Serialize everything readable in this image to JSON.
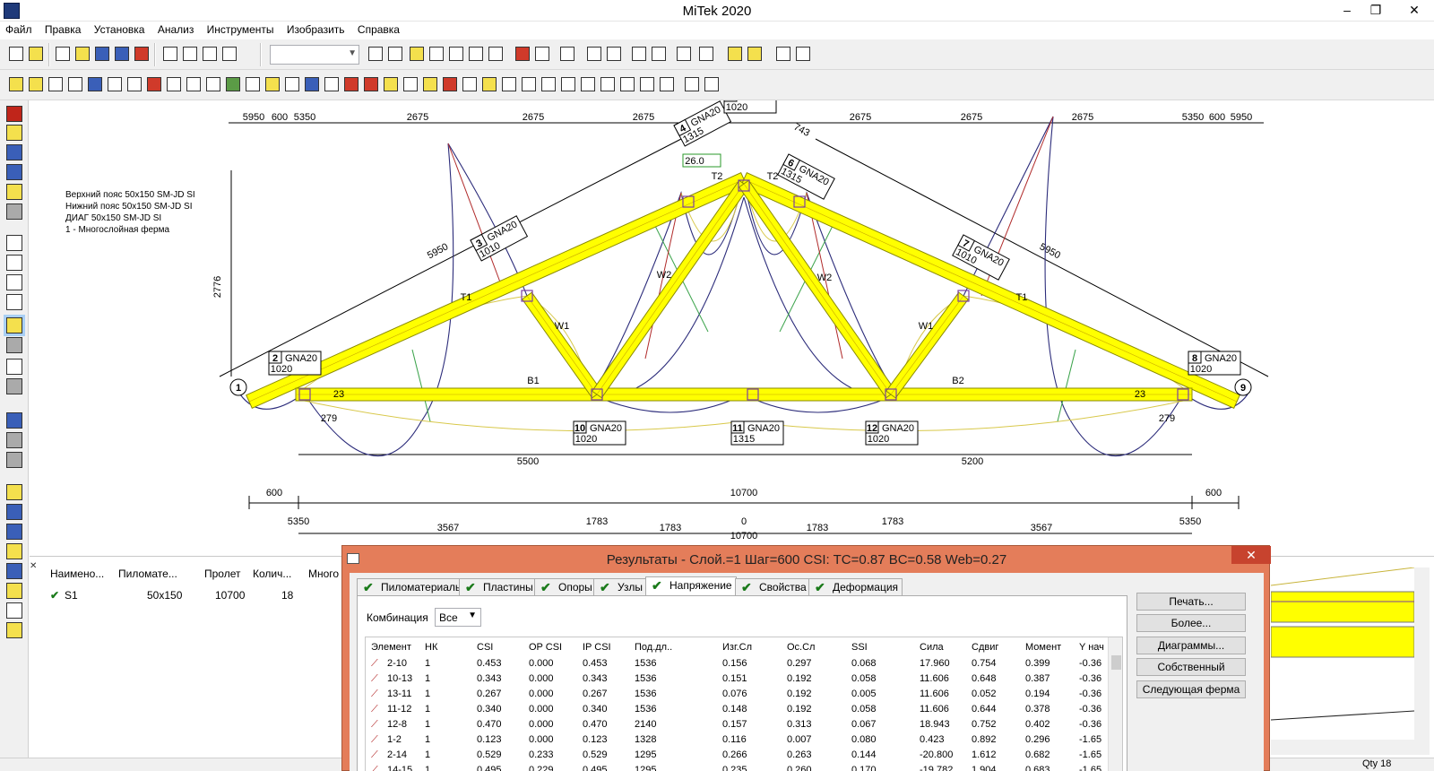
{
  "window": {
    "title": "MiTek 2020",
    "minimize_glyph": "–",
    "restore_glyph": "❐",
    "close_glyph": "✕"
  },
  "menu": {
    "items": [
      "Файл",
      "Правка",
      "Установка",
      "Анализ",
      "Инструменты",
      "Изобразить",
      "Справка"
    ]
  },
  "drawing": {
    "material_notes": [
      "Верхний пояс 50x150 SM-JD SI",
      "Нижний пояс 50x150 SM-JD SI",
      "ДИАГ 50x150 SM-JD SI",
      "1 - Многослойная ферма"
    ],
    "top_dims": [
      "5950",
      "600",
      "5350",
      "2675",
      "2675",
      "2675",
      "2675",
      "2675",
      "2675",
      "5350",
      "600",
      "5950"
    ],
    "height_dim": "2776",
    "slope_dims": [
      "5950",
      "5950",
      "743",
      "743"
    ],
    "member_labels": [
      "T1",
      "T1",
      "T2",
      "T2",
      "W1",
      "W1",
      "W2",
      "W2",
      "B1",
      "B2"
    ],
    "plates": [
      {
        "num": "2",
        "type": "GNA20",
        "size": "1020"
      },
      {
        "num": "3",
        "type": "GNA20",
        "size": "1010"
      },
      {
        "num": "4",
        "type": "GNA20",
        "size": "1315"
      },
      {
        "num": "5",
        "type": "GNA20",
        "size": "1020"
      },
      {
        "num": "6",
        "type": "GNA20",
        "size": "1315"
      },
      {
        "num": "7",
        "type": "GNA20",
        "size": "1010"
      },
      {
        "num": "8",
        "type": "GNA20",
        "size": "1020"
      },
      {
        "num": "10",
        "type": "GNA20",
        "size": "1020"
      },
      {
        "num": "11",
        "type": "GNA20",
        "size": "1315"
      },
      {
        "num": "12",
        "type": "GNA20",
        "size": "1020"
      }
    ],
    "angle_label": "26.0",
    "support_nodes": [
      "1",
      "9"
    ],
    "heel_labels": [
      "23",
      "279",
      "23",
      "279"
    ],
    "bottom_dims_1": [
      "5500",
      "5200"
    ],
    "bottom_dims_2": [
      "600",
      "10700",
      "600"
    ],
    "bottom_dims_3": [
      "5350",
      "3567",
      "1783",
      "1783",
      "0",
      "1783",
      "1783",
      "3567",
      "5350"
    ],
    "bottom_total": "10700"
  },
  "bottom_panel": {
    "columns": [
      "Наимено...",
      "Пиломате...",
      "Пролет",
      "Колич...",
      "Много"
    ],
    "row": {
      "name": "S1",
      "lumber": "50x150",
      "span": "10700",
      "qty": "18"
    }
  },
  "status": {
    "qty": "Qty 18"
  },
  "dialog": {
    "title": "Результаты - Слой.=1 Шаг=600 CSI: TC=0.87 BC=0.58 Web=0.27",
    "tabs": [
      "Пиломатериалы",
      "Пластины",
      "Опоры",
      "Узлы",
      "Напряжение",
      "Свойства",
      "Деформация"
    ],
    "active_tab": "Напряжение",
    "combo_label": "Комбинация",
    "combo_value": "Все",
    "table_columns": [
      "Элемент",
      "НК",
      "CSI",
      "OP CSI",
      "IP CSI",
      "Под.дл..",
      "Изг.Сл",
      "Ос.Сл",
      "SSI",
      "Сила",
      "Сдвиг",
      "Момент",
      "Y нач"
    ],
    "rows": [
      [
        "2-10",
        "1",
        "0.453",
        "0.000",
        "0.453",
        "1536",
        "0.156",
        "0.297",
        "0.068",
        "17.960",
        "0.754",
        "0.399",
        "-0.36"
      ],
      [
        "10-13",
        "1",
        "0.343",
        "0.000",
        "0.343",
        "1536",
        "0.151",
        "0.192",
        "0.058",
        "11.606",
        "0.648",
        "0.387",
        "-0.36"
      ],
      [
        "13-11",
        "1",
        "0.267",
        "0.000",
        "0.267",
        "1536",
        "0.076",
        "0.192",
        "0.005",
        "11.606",
        "0.052",
        "0.194",
        "-0.36"
      ],
      [
        "11-12",
        "1",
        "0.340",
        "0.000",
        "0.340",
        "1536",
        "0.148",
        "0.192",
        "0.058",
        "11.606",
        "0.644",
        "0.378",
        "-0.36"
      ],
      [
        "12-8",
        "1",
        "0.470",
        "0.000",
        "0.470",
        "2140",
        "0.157",
        "0.313",
        "0.067",
        "18.943",
        "0.752",
        "0.402",
        "-0.36"
      ],
      [
        "1-2",
        "1",
        "0.123",
        "0.000",
        "0.123",
        "1328",
        "0.116",
        "0.007",
        "0.080",
        "0.423",
        "0.892",
        "0.296",
        "-1.65"
      ],
      [
        "2-14",
        "1",
        "0.529",
        "0.233",
        "0.529",
        "1295",
        "0.266",
        "0.263",
        "0.144",
        "-20.800",
        "1.612",
        "0.682",
        "-1.65"
      ],
      [
        "14-15",
        "1",
        "0.495",
        "0.229",
        "0.495",
        "1295",
        "0.235",
        "0.260",
        "0.170",
        "-19.782",
        "1.904",
        "0.683",
        "-1.65"
      ]
    ],
    "buttons": [
      "Печать...",
      "Более...",
      "Диаграммы...",
      "Собственный",
      "Следующая ферма"
    ]
  },
  "colors": {
    "chord_fill": "#ffff00",
    "chord_stroke": "#8a8a00",
    "plate": "#7b3fa0",
    "moment_line": "#2b2b7a",
    "deflection_line": "#d8c84a",
    "dialog_frame": "#e47d5a"
  }
}
